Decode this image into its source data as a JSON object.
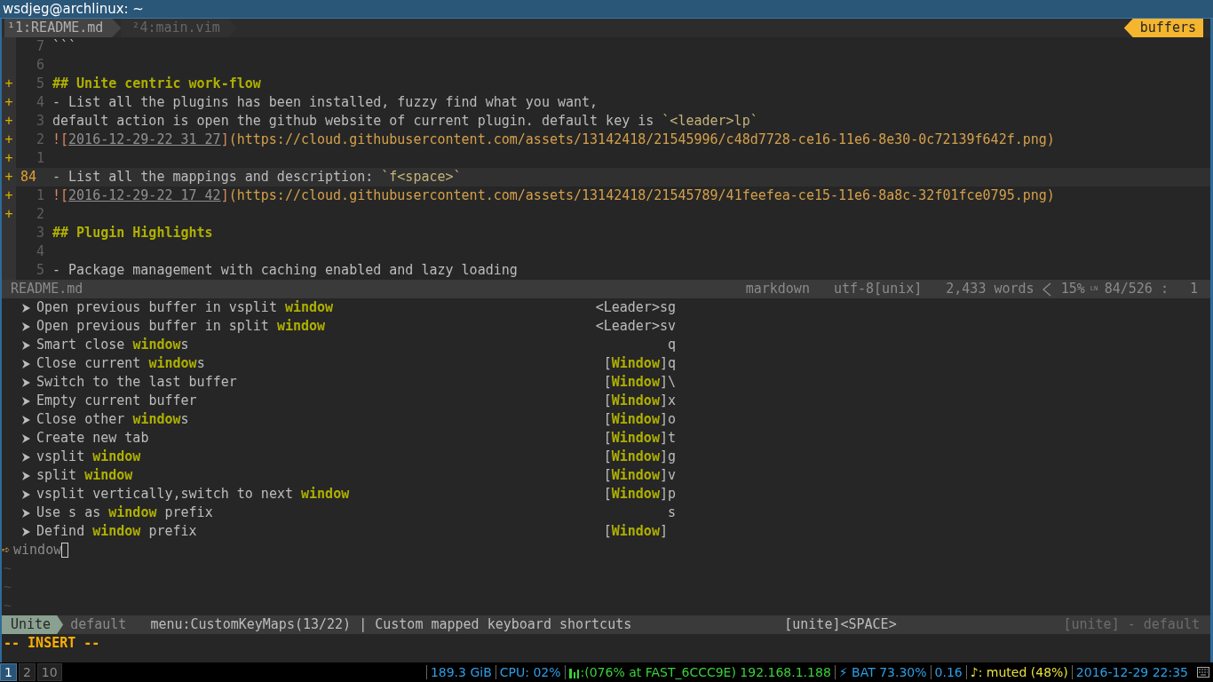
{
  "window": {
    "title": "wsdjeg@archlinux: ~"
  },
  "tabline": {
    "tabs": [
      {
        "label": "¹1:README.md",
        "selected": true
      },
      {
        "label": "²4:main.vim",
        "selected": false
      }
    ],
    "buffers_label": "buffers"
  },
  "editor": {
    "lines": [
      {
        "number": "7",
        "current": false,
        "segments": [
          {
            "kind": "text",
            "text": "```"
          }
        ]
      },
      {
        "number": "6",
        "current": false
      },
      {
        "sign": "+",
        "number": "5",
        "current": false,
        "segments": [
          {
            "kind": "heading",
            "text": "## Unite centric work-flow"
          }
        ]
      },
      {
        "sign": "+",
        "number": "4",
        "current": false,
        "segments": [
          {
            "kind": "text",
            "text": "- List all the plugins has been installed, fuzzy find what you want,"
          }
        ]
      },
      {
        "sign": "+",
        "number": "3",
        "current": false,
        "segments": [
          {
            "kind": "text",
            "text": "default action is open the github website of current plugin. default key is "
          },
          {
            "kind": "code",
            "text": "`<leader>lp`"
          }
        ]
      },
      {
        "sign": "+",
        "number": "2",
        "current": false,
        "segments": [
          {
            "kind": "punct",
            "text": "!["
          },
          {
            "kind": "link_text",
            "text": "2016-12-29-22 31 27"
          },
          {
            "kind": "punct",
            "text": "]"
          },
          {
            "kind": "url",
            "text": "(https://cloud.githubusercontent.com/assets/13142418/21545996/c48d7728-ce16-11e6-8e30-0c72139f642f.png)"
          }
        ]
      },
      {
        "sign": "+",
        "number": "1",
        "current": false
      },
      {
        "sign": "+",
        "number": "84",
        "current": true,
        "segments": [
          {
            "kind": "text",
            "text": "- List all the mappings and description: "
          },
          {
            "kind": "code",
            "text": "`f<space>`"
          }
        ]
      },
      {
        "sign": "+",
        "number": "1",
        "current": false,
        "segments": [
          {
            "kind": "punct",
            "text": "!["
          },
          {
            "kind": "link_text",
            "text": "2016-12-29-22 17 42"
          },
          {
            "kind": "punct",
            "text": "]"
          },
          {
            "kind": "url",
            "text": "(https://cloud.githubusercontent.com/assets/13142418/21545789/41feefea-ce15-11e6-8a8c-32f01fce0795.png)"
          }
        ]
      },
      {
        "sign": "+",
        "number": "2",
        "current": false
      },
      {
        "number": "3",
        "current": false,
        "segments": [
          {
            "kind": "heading",
            "text": "## Plugin Highlights"
          }
        ]
      },
      {
        "number": "4",
        "current": false
      },
      {
        "number": "5",
        "current": false,
        "segments": [
          {
            "kind": "text",
            "text": "- Package management with caching enabled and lazy loading"
          }
        ]
      }
    ]
  },
  "statusline": {
    "file": "README.md",
    "filetype": "markdown",
    "encoding": "utf-8[unix]",
    "words": "2,433 words",
    "percent": "15%",
    "line_symbol": "LN",
    "position": "84/526 :",
    "column": "1"
  },
  "unite": {
    "items": [
      {
        "text": "Open previous buffer in vsplit **window**",
        "key": "<Leader>sg"
      },
      {
        "text": "Open previous buffer in split **window**",
        "key": "<Leader>sv"
      },
      {
        "text": "Smart close **window**s",
        "key": "q"
      },
      {
        "text": "Close current **window**s",
        "key": "[**Window**]q"
      },
      {
        "text": "Switch to the last buffer",
        "key": "[**Window**]\\"
      },
      {
        "text": "Empty current buffer",
        "key": "[**Window**]x"
      },
      {
        "text": "Close other **window**s",
        "key": "[**Window**]o"
      },
      {
        "text": "Create new tab",
        "key": "[**Window**]t"
      },
      {
        "text": "vsplit **window**",
        "key": "[**Window**]g"
      },
      {
        "text": "split **window**",
        "key": "[**Window**]v"
      },
      {
        "text": "vsplit vertically,switch to next **window**",
        "key": "[**Window**]p"
      },
      {
        "text": "Use s as **window** prefix",
        "key": "s"
      },
      {
        "text": "Defind **window** prefix",
        "key": "[**Window**] "
      }
    ],
    "prompt": {
      "symbol": "➪",
      "value": "window"
    },
    "empty_lines": [
      "~",
      "~",
      "~"
    ],
    "status": {
      "mode": "Unite",
      "profile": "default",
      "source": "menu:CustomKeyMaps(13/22) | Custom mapped keyboard shortcuts",
      "key": "[unite]<SPACE>",
      "right": "[unite] - default"
    }
  },
  "mode_line": "-- INSERT --",
  "bar": {
    "workspaces": [
      {
        "label": "1",
        "selected": true
      },
      {
        "label": "2",
        "selected": false
      },
      {
        "label": "10",
        "selected": false
      }
    ],
    "blocks": [
      {
        "kind": "disk",
        "text": "189.3 GiB",
        "color": "#2e9ee6"
      },
      {
        "kind": "cpu",
        "text": "CPU: 02%",
        "color": "#2e9ee6"
      },
      {
        "kind": "wifi",
        "text": ":(076% at FAST_6CCC9E) 192.168.1.188",
        "color": "#3ad13a"
      },
      {
        "kind": "battery",
        "text": "⚡ BAT 73.30%",
        "color": "#2e9ee6"
      },
      {
        "kind": "load",
        "text": "0.16",
        "color": "#2e9ee6"
      },
      {
        "kind": "volume",
        "text": "♪: muted (48%)",
        "color": "#e8e03a"
      },
      {
        "kind": "clock",
        "text": "2016-12-29 22:35",
        "color": "#2e9ee6"
      }
    ]
  }
}
